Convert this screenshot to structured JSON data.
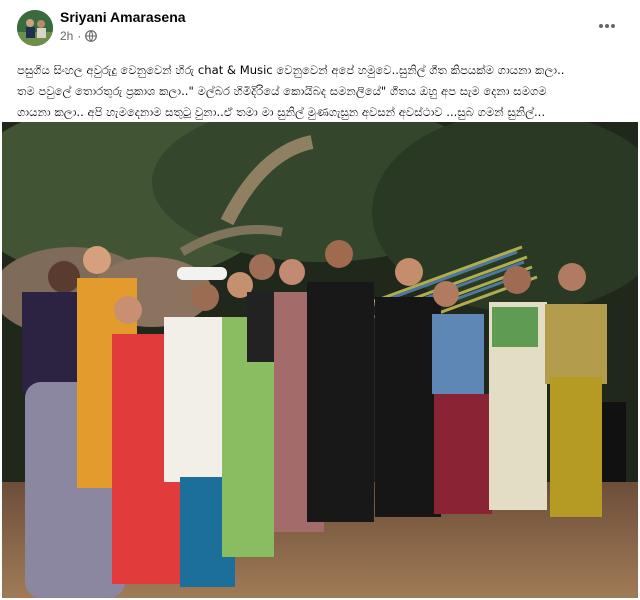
{
  "post": {
    "author": "Sriyani Amarasena",
    "timestamp": "2h",
    "audience_icon": "globe-icon",
    "more_icon": "more-options-icon",
    "caption_lines": [
      "පසුගිය සිංහල අවුරුදු වෙනුවෙන් හිරු chat & Music  වෙනුවෙන් අපේ හමුවෙ..සුනිල් ගීත කිපයක්ම ගායනා කලා..",
      "තම පවුලේ තොරතුරු ප්‍රකාශ කලා..\" මල්බර හිමිදිරියේ කොයිබද සමනලියේ\" ගීතය ඔහු අප සැම දෙනා සමගම",
      "ගායනා කලා.. අපි හැමදෙනාම සතුටු වුනා..ඒ තමා මා සුනිල් මුණගැසුන අවසන් අවස්ථාව ...සුබ ගමන් සුනිල්..."
    ],
    "photo_description": "group-photo"
  }
}
